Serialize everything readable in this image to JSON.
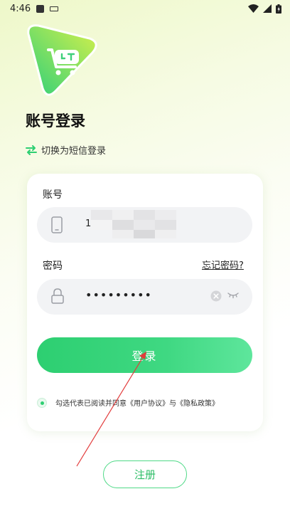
{
  "status_bar": {
    "time": "4:46"
  },
  "page_title": "账号登录",
  "switch_mode": {
    "label": "切换为短信登录"
  },
  "account": {
    "label": "账号",
    "value": "1"
  },
  "password": {
    "label": "密码",
    "value": "•••••••••",
    "forgot_label": "忘记密码?"
  },
  "login_button": {
    "label": "登录"
  },
  "agreement": {
    "text": "勾选代表已阅读并同意《用户协议》与《隐私政策》",
    "checked": true
  },
  "register_button": {
    "label": "注册"
  },
  "colors": {
    "brand_green": "#2ecf72",
    "logo_gradient_start": "#2fd07a",
    "logo_gradient_end": "#d6f04a"
  }
}
